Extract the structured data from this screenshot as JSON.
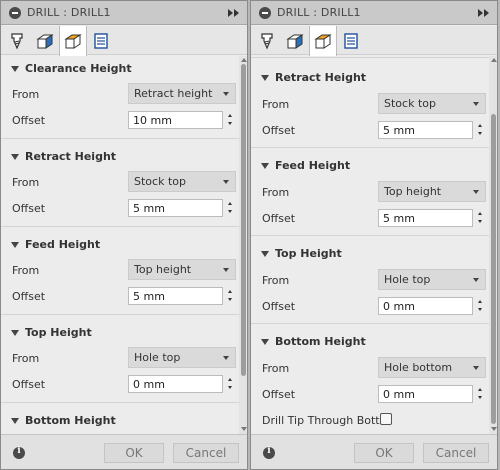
{
  "panels": [
    {
      "title": "DRILL : DRILL1",
      "tabs": [
        {
          "name": "tool-tab",
          "icon": "drill-tool-icon"
        },
        {
          "name": "geometry-tab",
          "icon": "geometry-box-icon"
        },
        {
          "name": "heights-tab",
          "icon": "heights-box-icon"
        },
        {
          "name": "cycle-tab",
          "icon": "cycle-list-icon"
        }
      ],
      "sections": [
        {
          "title": "Clearance Height",
          "from_label": "From",
          "from_value": "Retract height",
          "offset_label": "Offset",
          "offset_value": "10 mm"
        },
        {
          "title": "Retract Height",
          "from_label": "From",
          "from_value": "Stock top",
          "offset_label": "Offset",
          "offset_value": "5 mm"
        },
        {
          "title": "Feed Height",
          "from_label": "From",
          "from_value": "Top height",
          "offset_label": "Offset",
          "offset_value": "5 mm"
        },
        {
          "title": "Top Height",
          "from_label": "From",
          "from_value": "Hole top",
          "offset_label": "Offset",
          "offset_value": "0 mm"
        },
        {
          "title": "Bottom Height"
        }
      ],
      "scroll_fraction": 0.0,
      "ok_label": "OK",
      "cancel_label": "Cancel"
    },
    {
      "title": "DRILL : DRILL1",
      "tabs": [
        {
          "name": "tool-tab",
          "icon": "drill-tool-icon"
        },
        {
          "name": "geometry-tab",
          "icon": "geometry-box-icon"
        },
        {
          "name": "heights-tab",
          "icon": "heights-box-icon"
        },
        {
          "name": "cycle-tab",
          "icon": "cycle-list-icon"
        }
      ],
      "sections": [
        {
          "title": "Retract Height",
          "from_label": "From",
          "from_value": "Stock top",
          "offset_label": "Offset",
          "offset_value": "5 mm"
        },
        {
          "title": "Feed Height",
          "from_label": "From",
          "from_value": "Top height",
          "offset_label": "Offset",
          "offset_value": "5 mm"
        },
        {
          "title": "Top Height",
          "from_label": "From",
          "from_value": "Hole top",
          "offset_label": "Offset",
          "offset_value": "0 mm"
        },
        {
          "title": "Bottom Height",
          "from_label": "From",
          "from_value": "Hole bottom",
          "offset_label": "Offset",
          "offset_value": "0 mm"
        }
      ],
      "checkbox_label": "Drill Tip Through Bott...",
      "checkbox_checked": false,
      "scroll_fraction": 1.0,
      "ok_label": "OK",
      "cancel_label": "Cancel"
    }
  ],
  "colors": {
    "panel_bg": "#ececec",
    "titlebar_bg": "#c9c9c9",
    "toolbar_bg": "#e6e6e6",
    "select_bg": "#dadada",
    "accent_orange": "#f3a41f",
    "accent_blue": "#2d6fb7"
  }
}
